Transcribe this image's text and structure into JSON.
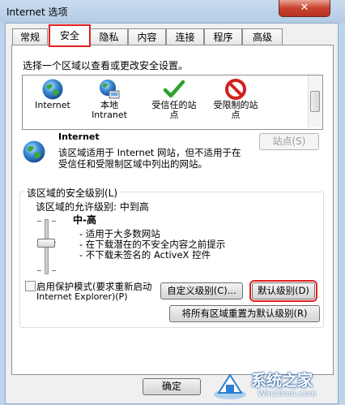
{
  "window": {
    "title": "Internet 选项",
    "close_glyph": "✕"
  },
  "tabs": [
    {
      "label": "常规"
    },
    {
      "label": "安全",
      "active": true
    },
    {
      "label": "隐私"
    },
    {
      "label": "内容"
    },
    {
      "label": "连接"
    },
    {
      "label": "程序"
    },
    {
      "label": "高级"
    }
  ],
  "zones": {
    "prompt": "选择一个区域以查看或更改安全设置。",
    "items": [
      {
        "label_1": "Internet",
        "label_2": "",
        "label_3": "",
        "icon": "globe-icon"
      },
      {
        "label_1": "本地",
        "label_2": "Intranet",
        "label_3": "",
        "icon": "intranet-globe-icon"
      },
      {
        "label_1": "受信任的站",
        "label_2": "点",
        "label_3": "",
        "icon": "green-check-icon"
      },
      {
        "label_1": "受限制的站",
        "label_2": "点",
        "label_3": "",
        "icon": "red-block-icon"
      }
    ]
  },
  "zone_info": {
    "name": "Internet",
    "desc_line1": "该区域适用于 Internet 网站，但不适用于在",
    "desc_line2": "受信任和受限制区域中列出的网站。",
    "sites_button": "站点(S)"
  },
  "security_level": {
    "group_title": "该区域的安全级别(L)",
    "allowed": "该区域的允许级别: 中到高",
    "level_name": "中-高",
    "bullets": [
      "- 适用于大多数网站",
      "- 在下载潜在的不安全内容之前提示",
      "- 不下载未签名的 ActiveX 控件"
    ],
    "slider_level_fraction": 0.5
  },
  "protected_mode": {
    "label_line1": "启用保护模式(要求重新启动",
    "label_line2": "Internet Explorer)(P)",
    "checked": false
  },
  "buttons": {
    "custom_level": "自定义级别(C)...",
    "default_level": "默认级别(D)",
    "reset_all": "将所有区域重置为默认级别(R)",
    "ok": "确定"
  },
  "watermark": {
    "brand": "系统之家",
    "url": "Win10net.com"
  },
  "colors": {
    "highlight_red": "#e02020",
    "panel_bg": "#ffffff",
    "titlebar": "#bcd3ea"
  }
}
